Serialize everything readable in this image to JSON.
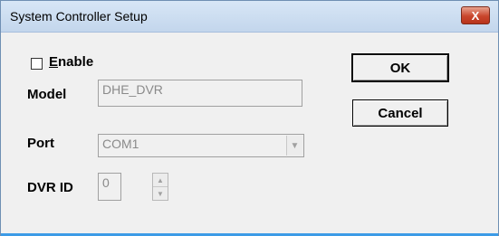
{
  "window": {
    "title": "System Controller Setup",
    "close_glyph": "X"
  },
  "form": {
    "enable_label_first": "E",
    "enable_label_rest": "nable",
    "enabled": false,
    "model_label": "Model",
    "model_value": "DHE_DVR",
    "port_label": "Port",
    "port_value": "COM1",
    "dvr_label": "DVR ID",
    "dvr_value": "0"
  },
  "buttons": {
    "ok": "OK",
    "cancel": "Cancel"
  },
  "icons": {
    "close": "close-icon",
    "dropdown": "chevron-down-icon",
    "spin_up": "spin-up-icon",
    "spin_down": "spin-down-icon"
  },
  "colors": {
    "title_bg": "#c3d6ec",
    "close_bg": "#c9462c",
    "accent_bottom": "#3c9be6"
  }
}
